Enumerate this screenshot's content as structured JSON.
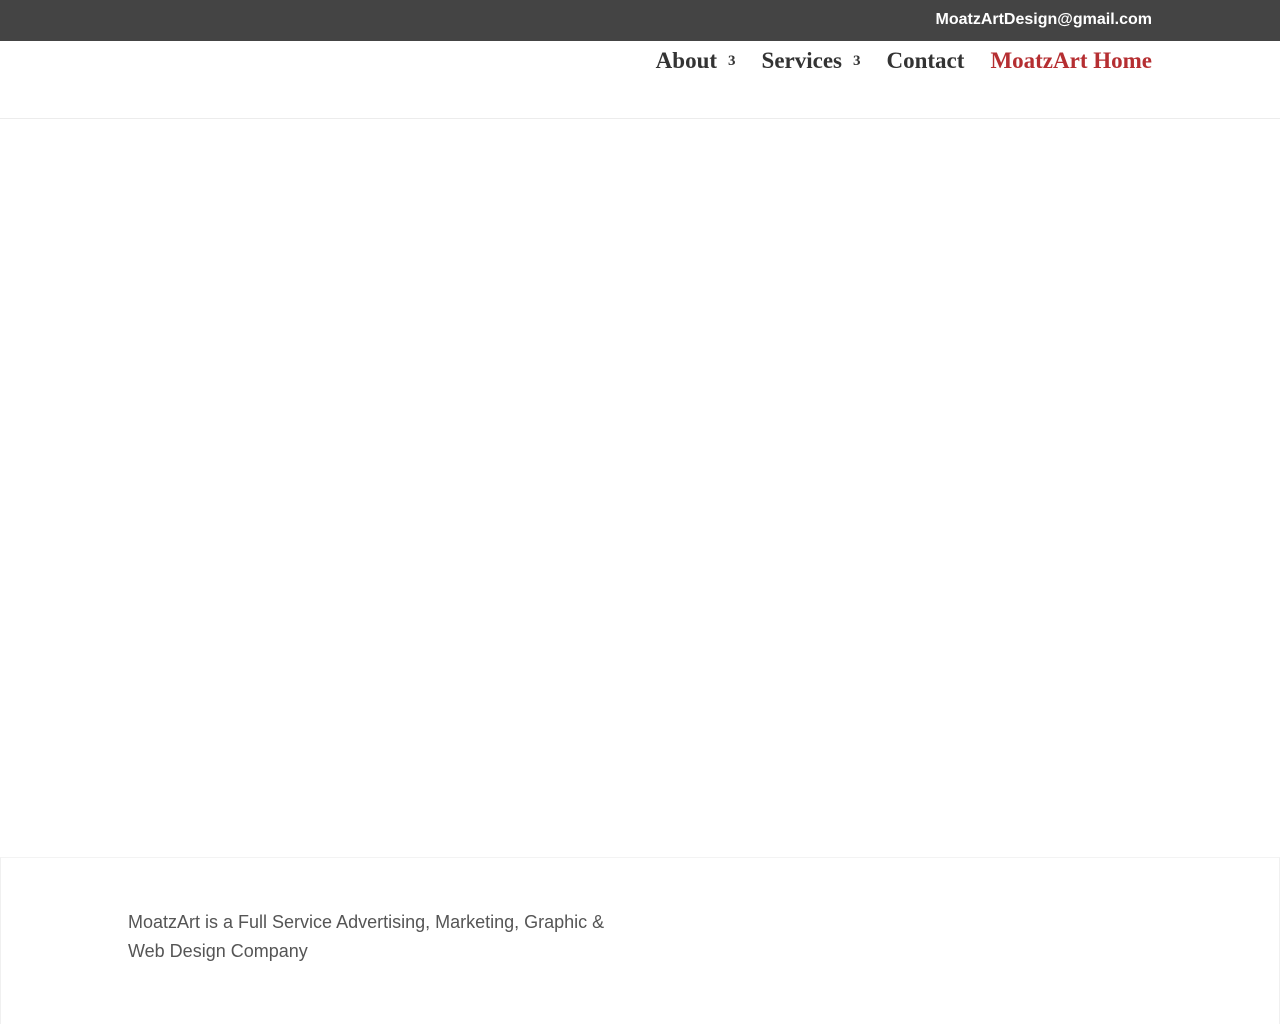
{
  "top_bar": {
    "email": "MoatzArtDesign@gmail.com"
  },
  "nav": {
    "items": [
      {
        "label": "About",
        "arrow": "3"
      },
      {
        "label": "Services",
        "arrow": "3"
      },
      {
        "label": "Contact"
      },
      {
        "label": "MoatzArt Home",
        "active": true
      }
    ]
  },
  "footer": {
    "description": "MoatzArt is a Full Service Advertising, Marketing, Graphic & Web Design Company"
  },
  "colors": {
    "top_bar_bg": "#444444",
    "nav_text": "#333333",
    "nav_active": "#b52e31",
    "footer_text": "#555555"
  }
}
